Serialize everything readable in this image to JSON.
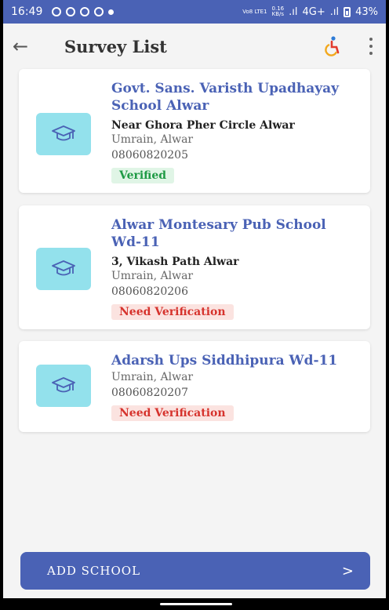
{
  "status_bar": {
    "time": "16:49",
    "net_label": "Vo8 LTE1",
    "speed_value": "0.16",
    "speed_unit": "KB/s",
    "signal_label": "4G+",
    "battery": "43%"
  },
  "app_bar": {
    "title": "Survey List",
    "back_icon": "arrow-back-icon",
    "accessibility_icon": "accessibility-icon",
    "more_icon": "more-vert-icon"
  },
  "schools": [
    {
      "name": "Govt.  Sans. Varisth Upadhayay School Alwar",
      "address": "Near Ghora Pher Circle Alwar",
      "area": "Umrain, Alwar",
      "phone": "08060820205",
      "status": "Verified"
    },
    {
      "name": "Alwar Montesary Pub School Wd-11",
      "address": "3, Vikash Path Alwar",
      "area": "Umrain, Alwar",
      "phone": "08060820206",
      "status": "Need Verification"
    },
    {
      "name": "Adarsh Ups Siddhipura Wd-11",
      "area": "Umrain, Alwar",
      "phone": "08060820207",
      "status": "Need Verification"
    }
  ],
  "add_button": {
    "label": "ADD SCHOOL",
    "chevron": ">"
  },
  "colors": {
    "primary": "#4a62b5",
    "icon_bg": "#93e1ec",
    "verified": "#1e9a44",
    "need_verification": "#d6332d"
  }
}
